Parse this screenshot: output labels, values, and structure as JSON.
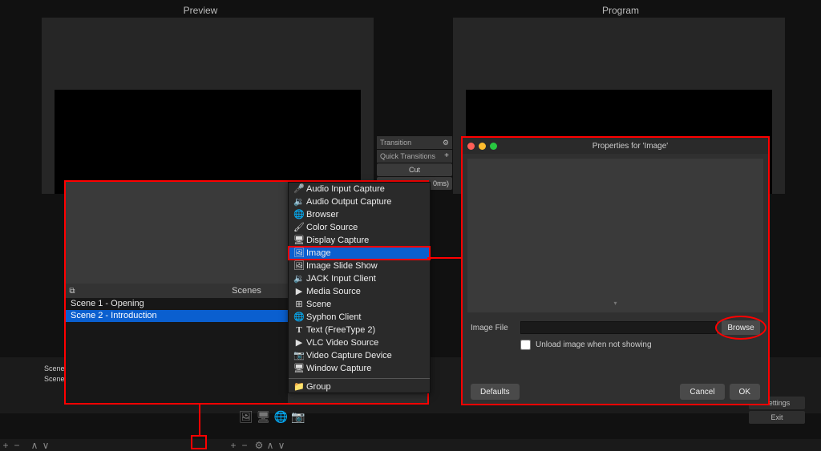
{
  "viewers": {
    "preview_label": "Preview",
    "program_label": "Program"
  },
  "transition": {
    "header": "Transition",
    "quick_header": "Quick Transitions",
    "cut_btn": "Cut",
    "duration_suffix": "0ms)"
  },
  "right_stack": {
    "settings": "Settings",
    "exit": "Exit"
  },
  "mini_scenes": {
    "a": "Scene",
    "b": "Scene"
  },
  "scenes_panel": {
    "title": "Scenes",
    "items": [
      {
        "label": "Scene 1 - Opening",
        "selected": false
      },
      {
        "label": "Scene 2 - Introduction",
        "selected": true
      }
    ]
  },
  "source_menu": {
    "items": [
      {
        "icon": "🎤",
        "label": "Audio Input Capture",
        "name": "audio-input-capture"
      },
      {
        "icon": "🔊",
        "label": "Audio Output Capture",
        "name": "audio-output-capture"
      },
      {
        "icon": "🌐",
        "label": "Browser",
        "name": "browser"
      },
      {
        "icon": "🖌",
        "label": "Color Source",
        "name": "color-source"
      },
      {
        "icon": "🖥",
        "label": "Display Capture",
        "name": "display-capture"
      },
      {
        "icon": "🖼",
        "label": "Image",
        "name": "image",
        "selected": true,
        "highlight": true
      },
      {
        "icon": "🖼",
        "label": "Image Slide Show",
        "name": "image-slide-show"
      },
      {
        "icon": "🔊",
        "label": "JACK Input Client",
        "name": "jack-input-client"
      },
      {
        "icon": "▶",
        "label": "Media Source",
        "name": "media-source"
      },
      {
        "icon": "⊞",
        "label": "Scene",
        "name": "scene-source"
      },
      {
        "icon": "🌐",
        "label": "Syphon Client",
        "name": "syphon-client"
      },
      {
        "icon": "T",
        "label": "Text (FreeType 2)",
        "name": "text-freetype2"
      },
      {
        "icon": "▶",
        "label": "VLC Video Source",
        "name": "vlc-video-source"
      },
      {
        "icon": "📷",
        "label": "Video Capture Device",
        "name": "video-capture-device"
      },
      {
        "icon": "🖥",
        "label": "Window Capture",
        "name": "window-capture"
      }
    ],
    "group_label": "Group"
  },
  "properties_dialog": {
    "title": "Properties for 'Image'",
    "image_file_label": "Image File",
    "image_file_value": "",
    "browse_label": "Browse",
    "unload_checkbox_label": "Unload image when not showing",
    "unload_checked": false,
    "defaults_btn": "Defaults",
    "cancel_btn": "Cancel",
    "ok_btn": "OK"
  },
  "toolbar_icons": {
    "plus": "+",
    "minus": "−",
    "up": "∧",
    "down": "∨",
    "gear": "⚙"
  }
}
